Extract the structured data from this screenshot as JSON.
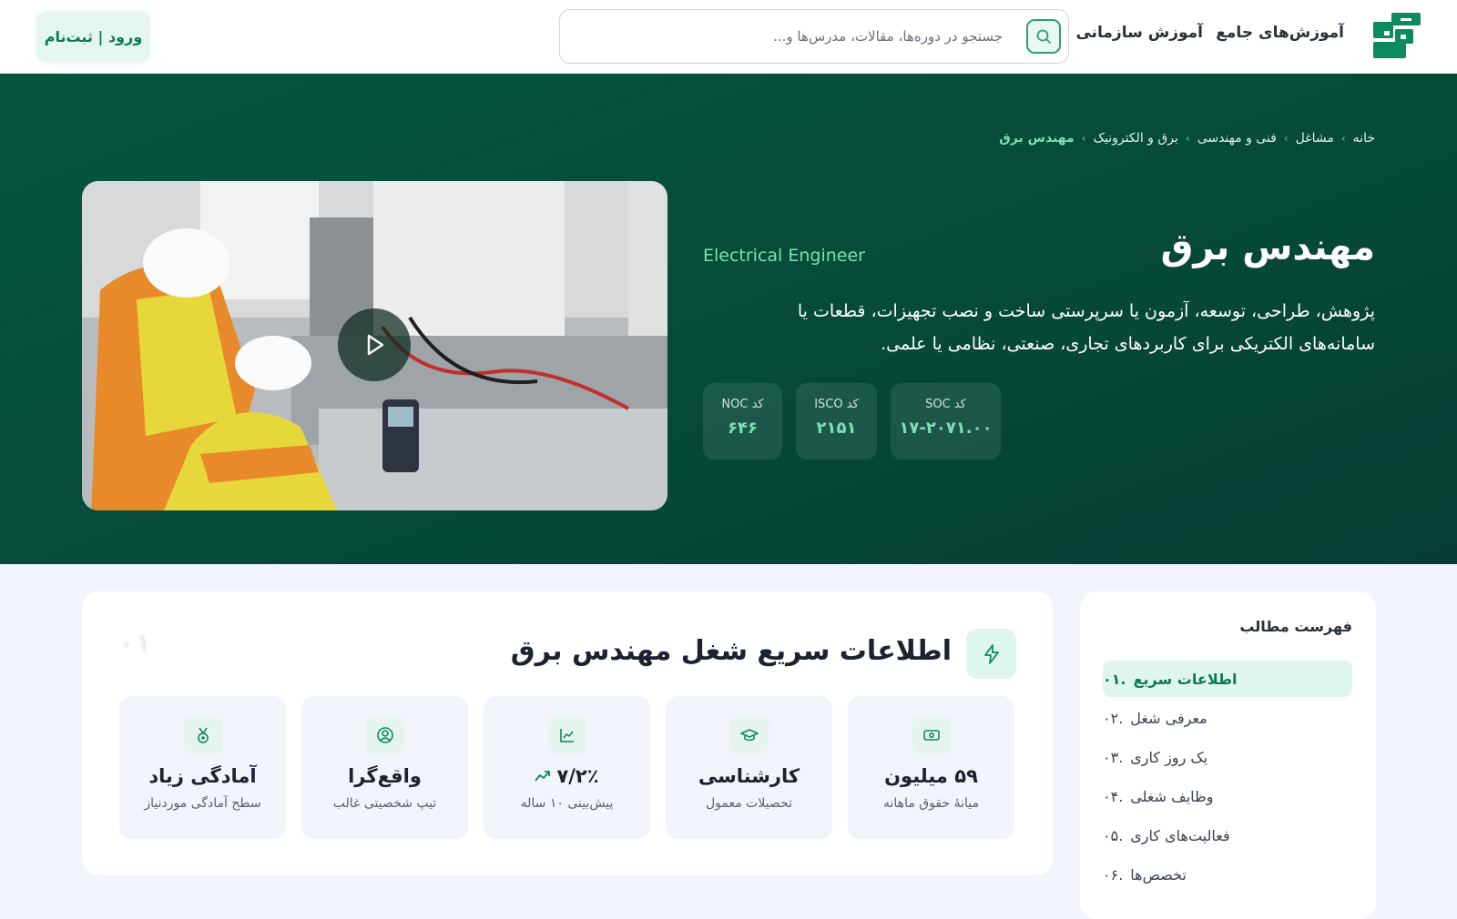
{
  "header": {
    "nav": [
      "آموزش‌های جامع",
      "آموزش سازمانی"
    ],
    "search_placeholder": "جستجو در دوره‌ها، مقالات، مدرس‌ها و...",
    "login_label": "ورود | ثبت‌نام"
  },
  "hero": {
    "breadcrumb": [
      "خانه",
      "مشاغل",
      "فنی و مهندسی",
      "برق و الکترونیک",
      "مهندس برق"
    ],
    "title": "مهندس برق",
    "title_en": "Electrical Engineer",
    "description": "پژوهش، طراحی، توسعه، آزمون یا سرپرستی ساخت و نصب تجهیزات، قطعات یا سامانه‌های الکتریکی برای کاربردهای تجاری، صنعتی، نظامی یا علمی.",
    "codes": {
      "soc": {
        "label": "کد SOC",
        "value": "۱۷-۲۰۷۱.۰۰"
      },
      "isco": {
        "label": "کد ISCO",
        "value": "۲۱۵۱"
      },
      "noc": {
        "label": "کد NOC",
        "value": "۶۴۶"
      }
    }
  },
  "toc": {
    "title": "فهرست مطالب",
    "items": [
      {
        "num": "۰۱.",
        "label": "اطلاعات سریع"
      },
      {
        "num": "۰۲.",
        "label": "معرفی شغل"
      },
      {
        "num": "۰۳.",
        "label": "یک روز کاری"
      },
      {
        "num": "۰۴.",
        "label": "وظایف شغلی"
      },
      {
        "num": "۰۵.",
        "label": "فعالیت‌های کاری"
      },
      {
        "num": "۰۶.",
        "label": "تخصص‌ها"
      }
    ]
  },
  "facts": {
    "title": "اطلاعات سریع شغل مهندس برق",
    "section_num": "۰۱",
    "items": [
      {
        "icon": "money-icon",
        "value": "۵۹ میلیون",
        "label": "میانهٔ حقوق ماهانه"
      },
      {
        "icon": "graduation-cap-icon",
        "value": "کارشناسی",
        "label": "تحصیلات معمول"
      },
      {
        "icon": "chart-line-icon",
        "value": "۷/۲٪",
        "label": "پیش‌بینی ۱۰ ساله"
      },
      {
        "icon": "user-circle-icon",
        "value": "واقع‌گرا",
        "label": "تیپ شخصیتی غالب"
      },
      {
        "icon": "medal-icon",
        "value": "آمادگی زیاد",
        "label": "سطح آمادگی موردنیاز"
      }
    ]
  },
  "colors": {
    "brand": "#0d8a5f",
    "hero_bg": "#05563e",
    "accent": "#7ce0b4"
  }
}
